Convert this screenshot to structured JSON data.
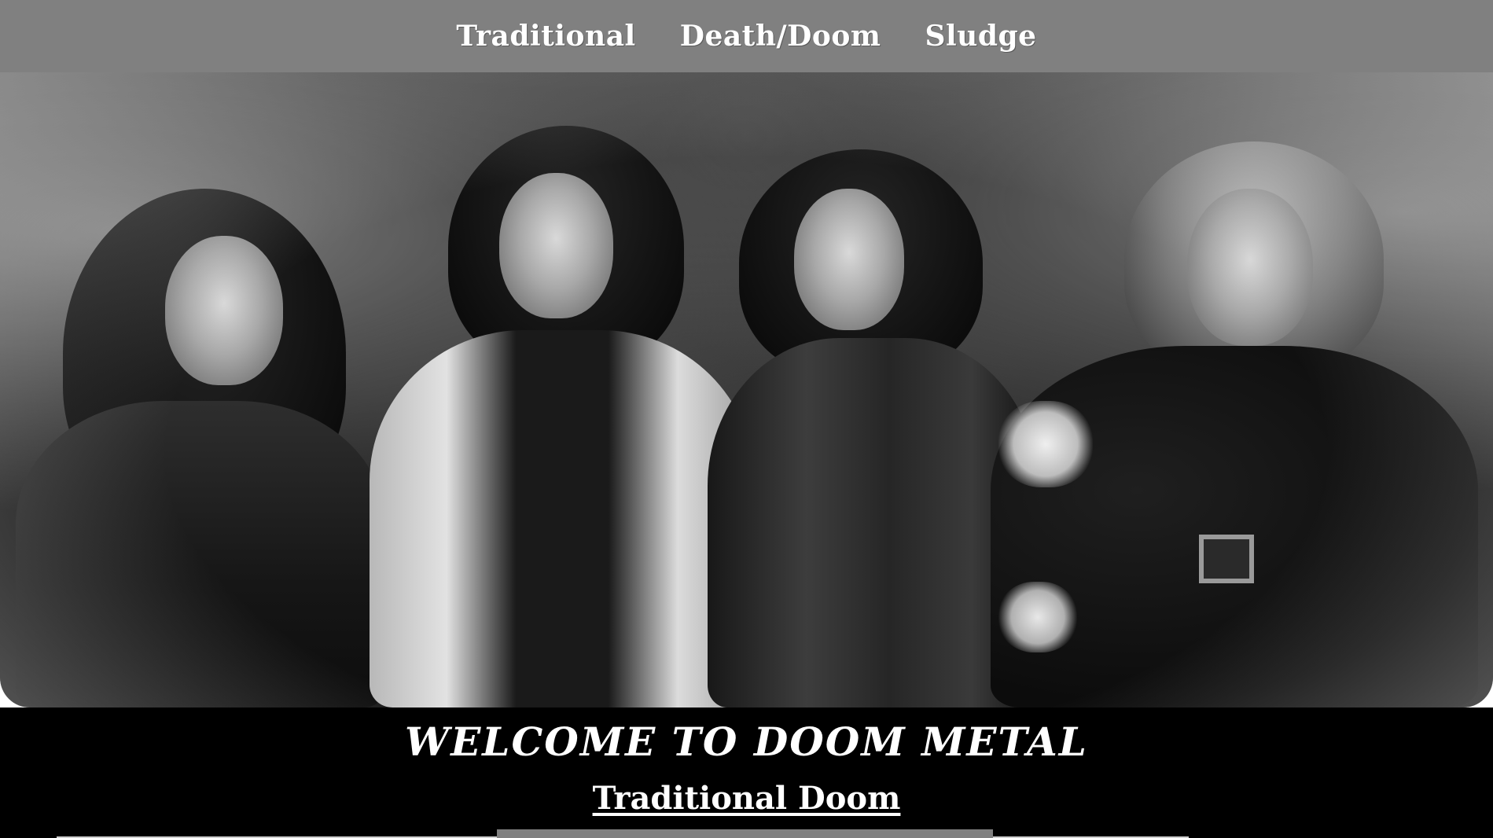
{
  "nav": {
    "links": [
      {
        "label": "Traditional"
      },
      {
        "label": "Death/Doom"
      },
      {
        "label": "Sludge"
      }
    ]
  },
  "hero": {
    "image_subject": "black-and-white band photo",
    "alt": "band-photo"
  },
  "main": {
    "heading": "WELCOME TO DOOM METAL",
    "subheading": "Traditional Doom"
  },
  "colors": {
    "nav_bg": "#808080",
    "page_bg": "#000000",
    "text": "#ffffff"
  }
}
